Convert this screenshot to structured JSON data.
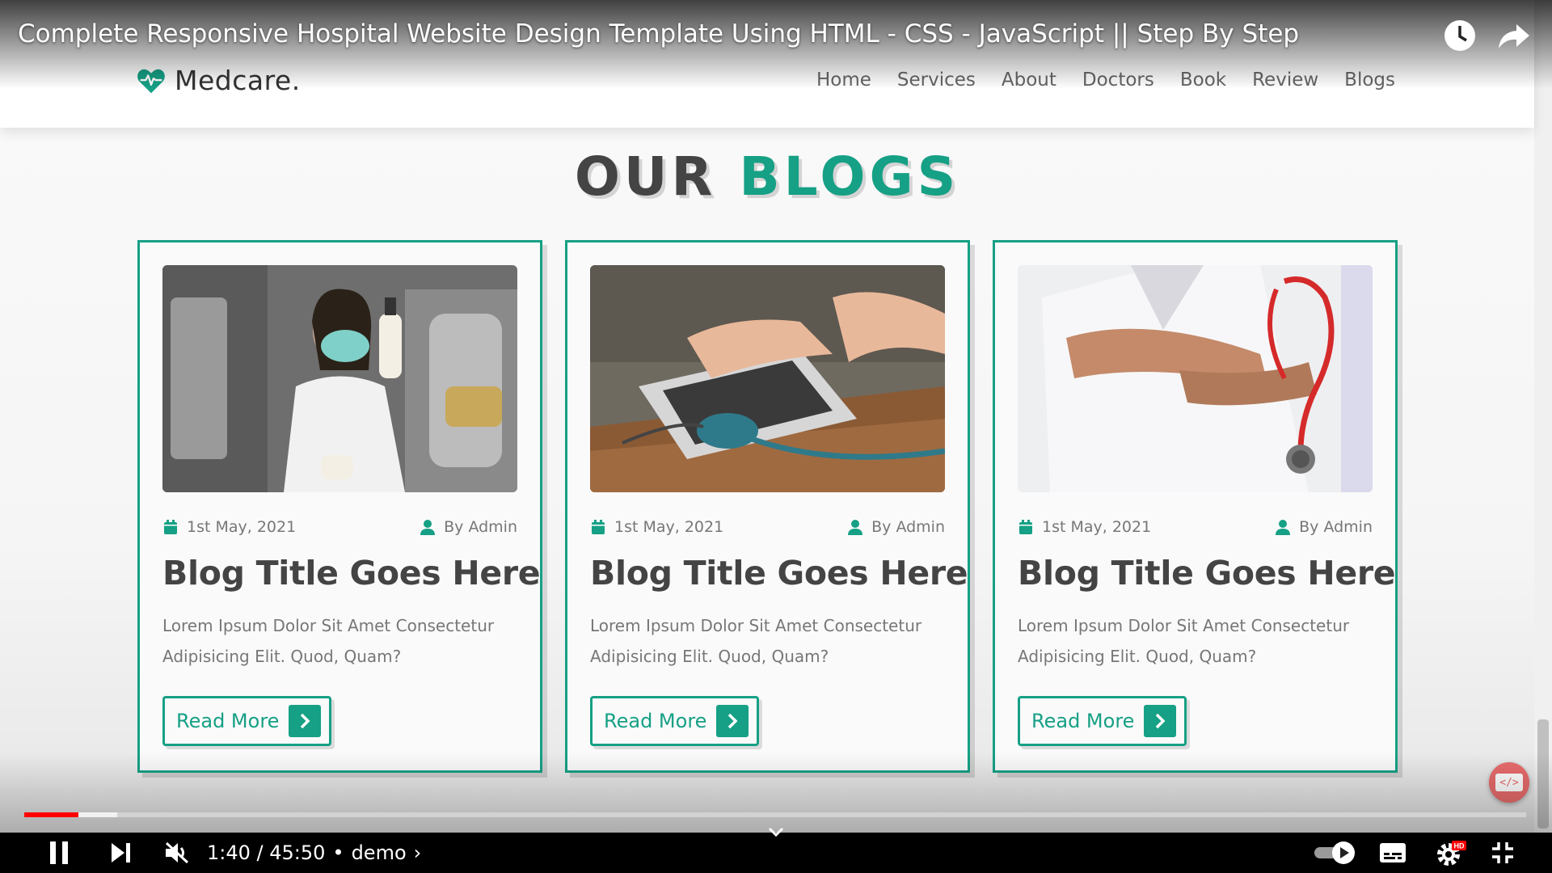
{
  "video": {
    "title": "Complete Responsive Hospital Website Design Template Using HTML - CSS - JavaScript || Step By Step",
    "time_display": "1:40 / 45:50",
    "separator": "•",
    "chapter": "demo",
    "chapter_chevron": "›",
    "progress_played_fraction": 0.036,
    "progress_buffered_fraction": 0.062,
    "icons": {
      "watch_later": "clock-icon",
      "share": "share-icon",
      "pause": "pause-icon",
      "next": "next-icon",
      "mute": "muted-volume-icon",
      "autoplay": "autoplay-toggle-icon",
      "captions": "captions-icon",
      "settings": "settings-icon",
      "exit_fullscreen": "exit-fullscreen-icon",
      "chevron": "chevron-down-icon"
    },
    "settings_badge": "HD"
  },
  "site": {
    "brand": "Medcare.",
    "accent": "#16a085",
    "nav": [
      "Home",
      "Services",
      "About",
      "Doctors",
      "Book",
      "Review",
      "Blogs"
    ],
    "heading": {
      "word1": "OUR",
      "word2": "BLOGS"
    },
    "dev_badge": "</>",
    "blogs": [
      {
        "date": "1st May, 2021",
        "author": "By Admin",
        "title": "Blog Title Goes Here",
        "text": "Lorem Ipsum Dolor Sit Amet Consectetur Adipisicing Elit. Quod, Quam?",
        "button": "Read More"
      },
      {
        "date": "1st May, 2021",
        "author": "By Admin",
        "title": "Blog Title Goes Here",
        "text": "Lorem Ipsum Dolor Sit Amet Consectetur Adipisicing Elit. Quod, Quam?",
        "button": "Read More"
      },
      {
        "date": "1st May, 2021",
        "author": "By Admin",
        "title": "Blog Title Goes Here",
        "text": "Lorem Ipsum Dolor Sit Amet Consectetur Adipisicing Elit. Quod, Quam?",
        "button": "Read More"
      }
    ]
  }
}
